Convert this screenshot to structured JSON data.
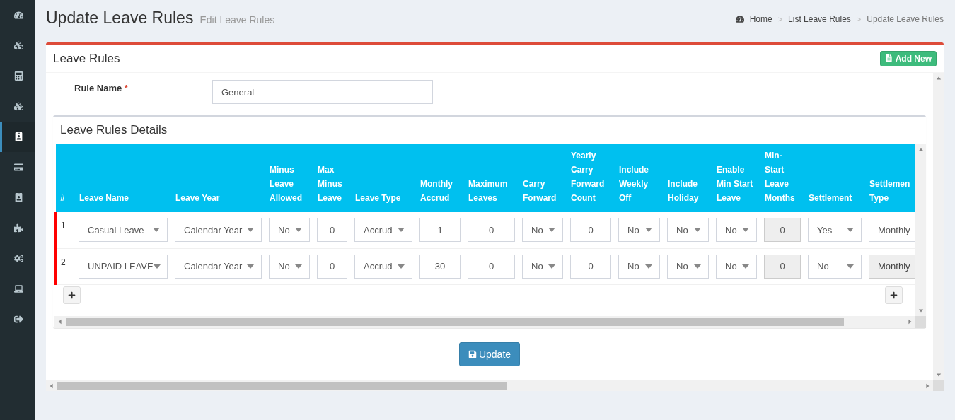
{
  "sidebar": {
    "items": [
      {
        "selected": false
      },
      {
        "selected": false
      },
      {
        "selected": false
      },
      {
        "selected": false
      },
      {
        "selected": true
      },
      {
        "selected": false
      },
      {
        "selected": false
      },
      {
        "selected": false
      },
      {
        "selected": false
      },
      {
        "selected": false
      },
      {
        "selected": false
      }
    ]
  },
  "page": {
    "title": "Update Leave Rules",
    "subtitle": "Edit Leave Rules"
  },
  "breadcrumb": [
    {
      "label": "Home"
    },
    {
      "label": "List Leave Rules"
    },
    {
      "label": "Update Leave Rules"
    }
  ],
  "breadcrumb_separators": [
    ">",
    ">"
  ],
  "card": {
    "title": "Leave Rules",
    "add_button": "Add New"
  },
  "rule_name": {
    "label": "Rule Name",
    "required_mark": "*",
    "value": "General"
  },
  "details": {
    "title": "Leave Rules Details",
    "columns": [
      "#",
      "Leave Name",
      "Leave Year",
      "Minus Leave Allowed",
      "Max Minus Leave",
      "Leave Type",
      "Monthly Accrud",
      "Maximum Leaves",
      "Carry Forward",
      "Yearly Carry Forward Count",
      "Include Weekly Off",
      "Include Holiday",
      "Enable Min Start Leave",
      "Min-Start Leave Months",
      "Settlement",
      "Settlemen Type"
    ],
    "rows": [
      {
        "cells": [
          {
            "kind": "number",
            "value": "1"
          },
          {
            "kind": "select",
            "value": "Casual Leave",
            "disabled": false
          },
          {
            "kind": "select",
            "value": "Calendar Year",
            "disabled": false
          },
          {
            "kind": "select",
            "value": "No",
            "disabled": false
          },
          {
            "kind": "input",
            "value": "0",
            "disabled": false
          },
          {
            "kind": "select",
            "value": "Accrud",
            "disabled": false
          },
          {
            "kind": "input",
            "value": "1",
            "disabled": false
          },
          {
            "kind": "input",
            "value": "0",
            "disabled": false
          },
          {
            "kind": "select",
            "value": "No",
            "disabled": false
          },
          {
            "kind": "input",
            "value": "0",
            "disabled": false
          },
          {
            "kind": "select",
            "value": "No",
            "disabled": false
          },
          {
            "kind": "select",
            "value": "No",
            "disabled": false
          },
          {
            "kind": "select",
            "value": "No",
            "disabled": false
          },
          {
            "kind": "input",
            "value": "0",
            "disabled": true
          },
          {
            "kind": "select",
            "value": "Yes",
            "disabled": false
          },
          {
            "kind": "select",
            "value": "Monthly",
            "disabled": false
          }
        ]
      },
      {
        "cells": [
          {
            "kind": "number",
            "value": "2"
          },
          {
            "kind": "select",
            "value": "UNPAID LEAVE",
            "disabled": false
          },
          {
            "kind": "select",
            "value": "Calendar Year",
            "disabled": false
          },
          {
            "kind": "select",
            "value": "No",
            "disabled": false
          },
          {
            "kind": "input",
            "value": "0",
            "disabled": false
          },
          {
            "kind": "select",
            "value": "Accrud",
            "disabled": false
          },
          {
            "kind": "input",
            "value": "30",
            "disabled": false
          },
          {
            "kind": "input",
            "value": "0",
            "disabled": false
          },
          {
            "kind": "select",
            "value": "No",
            "disabled": false
          },
          {
            "kind": "input",
            "value": "0",
            "disabled": false
          },
          {
            "kind": "select",
            "value": "No",
            "disabled": false
          },
          {
            "kind": "select",
            "value": "No",
            "disabled": false
          },
          {
            "kind": "select",
            "value": "No",
            "disabled": false
          },
          {
            "kind": "input",
            "value": "0",
            "disabled": true
          },
          {
            "kind": "select",
            "value": "No",
            "disabled": false
          },
          {
            "kind": "select",
            "value": "Monthly",
            "disabled": true
          }
        ]
      }
    ]
  },
  "update_button": "Update"
}
